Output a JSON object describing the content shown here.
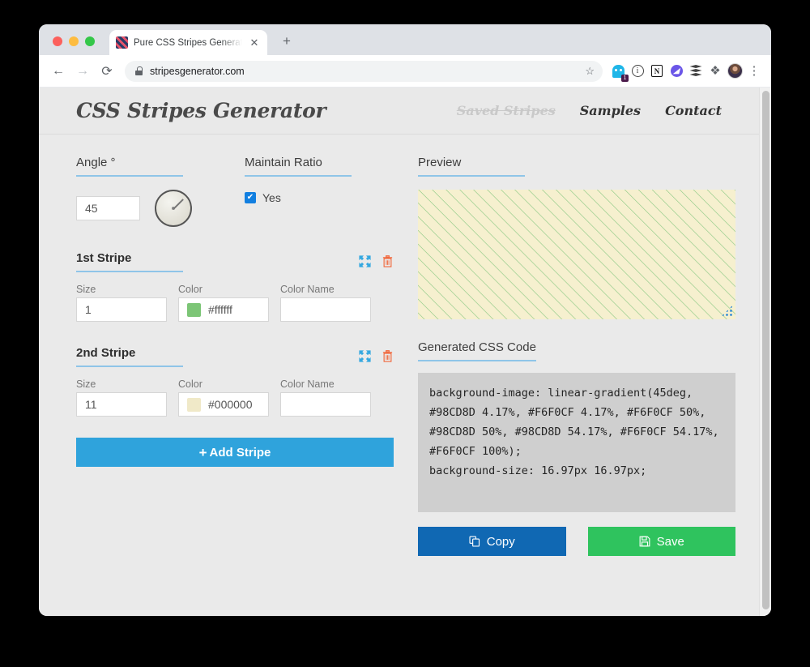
{
  "browser": {
    "tab": {
      "title": "Pure CSS Stripes Generator - N",
      "favicon": "striped-square-favicon",
      "close_label": "✕"
    },
    "newtab_label": "+",
    "nav": {
      "back": "←",
      "forward": "→",
      "reload": "⟳"
    },
    "omnibox": {
      "url": "stripesgenerator.com",
      "lock_icon": "lock-icon",
      "star_icon": "star-icon"
    },
    "extensions": [
      {
        "name": "ghost-extension-icon",
        "badge": "1"
      },
      {
        "name": "info-extension-icon"
      },
      {
        "name": "notion-extension-icon",
        "glyph": "N"
      },
      {
        "name": "purple-extension-icon",
        "glyph": "◢"
      },
      {
        "name": "layers-extension-icon"
      },
      {
        "name": "puzzle-extension-icon",
        "glyph": "❖"
      }
    ],
    "avatar": "profile-avatar",
    "menu_glyph": "⋮"
  },
  "site": {
    "logo": "CSS Stripes Generator",
    "nav": [
      {
        "label": "Saved Stripes",
        "disabled": true
      },
      {
        "label": "Samples",
        "disabled": false
      },
      {
        "label": "Contact",
        "disabled": false
      }
    ]
  },
  "controls": {
    "angle": {
      "label": "Angle °",
      "value": "45",
      "placeholder": "",
      "dial_name": "angle-dial"
    },
    "maintain_ratio": {
      "label": "Maintain Ratio",
      "checkbox_label": "Yes",
      "checked": true,
      "check_glyph": "✔"
    },
    "stripes": [
      {
        "title": "1st Stripe",
        "size_label": "Size",
        "size_value": "1",
        "color_label": "Color",
        "color_value": "#ffffff",
        "swatch_color": "#7cc576",
        "color_name_label": "Color Name",
        "color_name_value": "",
        "move_icon": "move-icon",
        "delete_icon": "trash-icon"
      },
      {
        "title": "2nd Stripe",
        "size_label": "Size",
        "size_value": "11",
        "color_label": "Color",
        "color_value": "#000000",
        "swatch_color": "#f0e9c8",
        "color_name_label": "Color Name",
        "color_name_value": "",
        "move_icon": "move-icon",
        "delete_icon": "trash-icon"
      }
    ],
    "add_stripe": {
      "label": "Add Stripe",
      "plus_glyph": "+"
    }
  },
  "preview": {
    "label": "Preview",
    "resize_grip": "resize-grip"
  },
  "code": {
    "label": "Generated CSS Code",
    "text": "background-image: linear-gradient(45deg, #98CD8D 4.17%, #F6F0CF 4.17%, #F6F0CF 50%, #98CD8D 50%, #98CD8D 54.17%, #F6F0CF 54.17%, #F6F0CF 100%);\nbackground-size: 16.97px 16.97px;"
  },
  "actions": {
    "copy": {
      "label": "Copy",
      "icon": "copy-icon"
    },
    "save": {
      "label": "Save",
      "icon": "floppy-disk-icon"
    }
  },
  "colors": {
    "stripe_green": "#98CD8D",
    "stripe_cream": "#F6F0CF",
    "accent_blue": "#2fa3dc",
    "copy_blue": "#1068b3",
    "save_green": "#2fc35e",
    "underline_blue": "#8fc5e8",
    "page_bg": "#eaeaea"
  }
}
